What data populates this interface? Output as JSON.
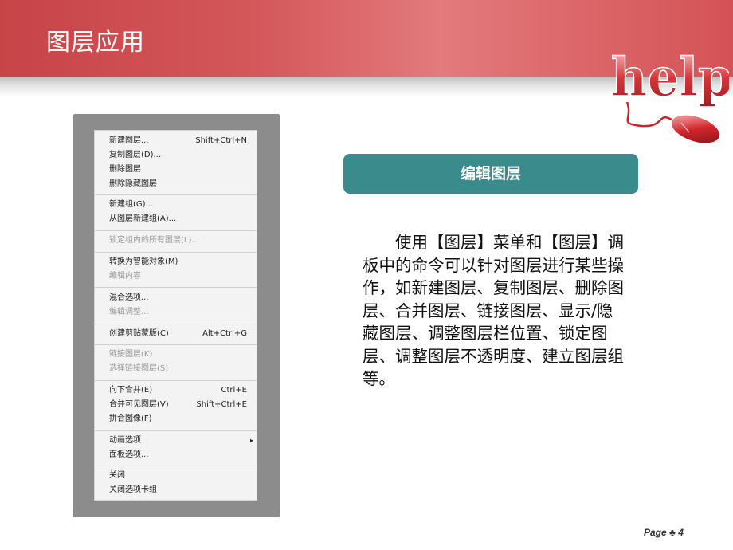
{
  "slide": {
    "title": "图层应用",
    "logo_text": "help",
    "page_label": "Page",
    "page_icon": "♣",
    "page_number": "4"
  },
  "menu": {
    "items": [
      {
        "label": "新建图层...",
        "shortcut": "Shift+Ctrl+N",
        "disabled": false
      },
      {
        "label": "复制图层(D)...",
        "shortcut": "",
        "disabled": false
      },
      {
        "label": "删除图层",
        "shortcut": "",
        "disabled": false
      },
      {
        "label": "删除隐藏图层",
        "shortcut": "",
        "disabled": false
      },
      {
        "label": "新建组(G)...",
        "shortcut": "",
        "disabled": false
      },
      {
        "label": "从图层新建组(A)...",
        "shortcut": "",
        "disabled": false
      },
      {
        "label": "锁定组内的所有图层(L)...",
        "shortcut": "",
        "disabled": true
      },
      {
        "label": "转换为智能对象(M)",
        "shortcut": "",
        "disabled": false
      },
      {
        "label": "编辑内容",
        "shortcut": "",
        "disabled": true
      },
      {
        "label": "混合选项...",
        "shortcut": "",
        "disabled": false
      },
      {
        "label": "编辑调整...",
        "shortcut": "",
        "disabled": true
      },
      {
        "label": "创建剪贴蒙版(C)",
        "shortcut": "Alt+Ctrl+G",
        "disabled": false
      },
      {
        "label": "链接图层(K)",
        "shortcut": "",
        "disabled": true
      },
      {
        "label": "选择链接图层(S)",
        "shortcut": "",
        "disabled": true
      },
      {
        "label": "向下合并(E)",
        "shortcut": "Ctrl+E",
        "disabled": false
      },
      {
        "label": "合并可见图层(V)",
        "shortcut": "Shift+Ctrl+E",
        "disabled": false
      },
      {
        "label": "拼合图像(F)",
        "shortcut": "",
        "disabled": false
      },
      {
        "label": "动画选项",
        "shortcut": "",
        "disabled": false,
        "submenu_arrow": "▸"
      },
      {
        "label": "面板选项...",
        "shortcut": "",
        "disabled": false
      },
      {
        "label": "关闭",
        "shortcut": "",
        "disabled": false
      },
      {
        "label": "关闭选项卡组",
        "shortcut": "",
        "disabled": false
      }
    ]
  },
  "section": {
    "heading": "编辑图层",
    "body": "使用【图层】菜单和【图层】调板中的命令可以针对图层进行某些操作，如新建图层、复制图层、删除图层、合并图层、链接图层、显示/隐藏图层、调整图层栏位置、锁定图层、调整图层不透明度、建立图层组等。"
  },
  "colors": {
    "header_red": "#c74447",
    "banner_teal": "#398b8c",
    "menu_frame_gray": "#8c8c8c"
  },
  "icons": {
    "logo": "help-mouse-logo-icon",
    "page": "club-icon",
    "submenu": "submenu-arrow-icon"
  }
}
